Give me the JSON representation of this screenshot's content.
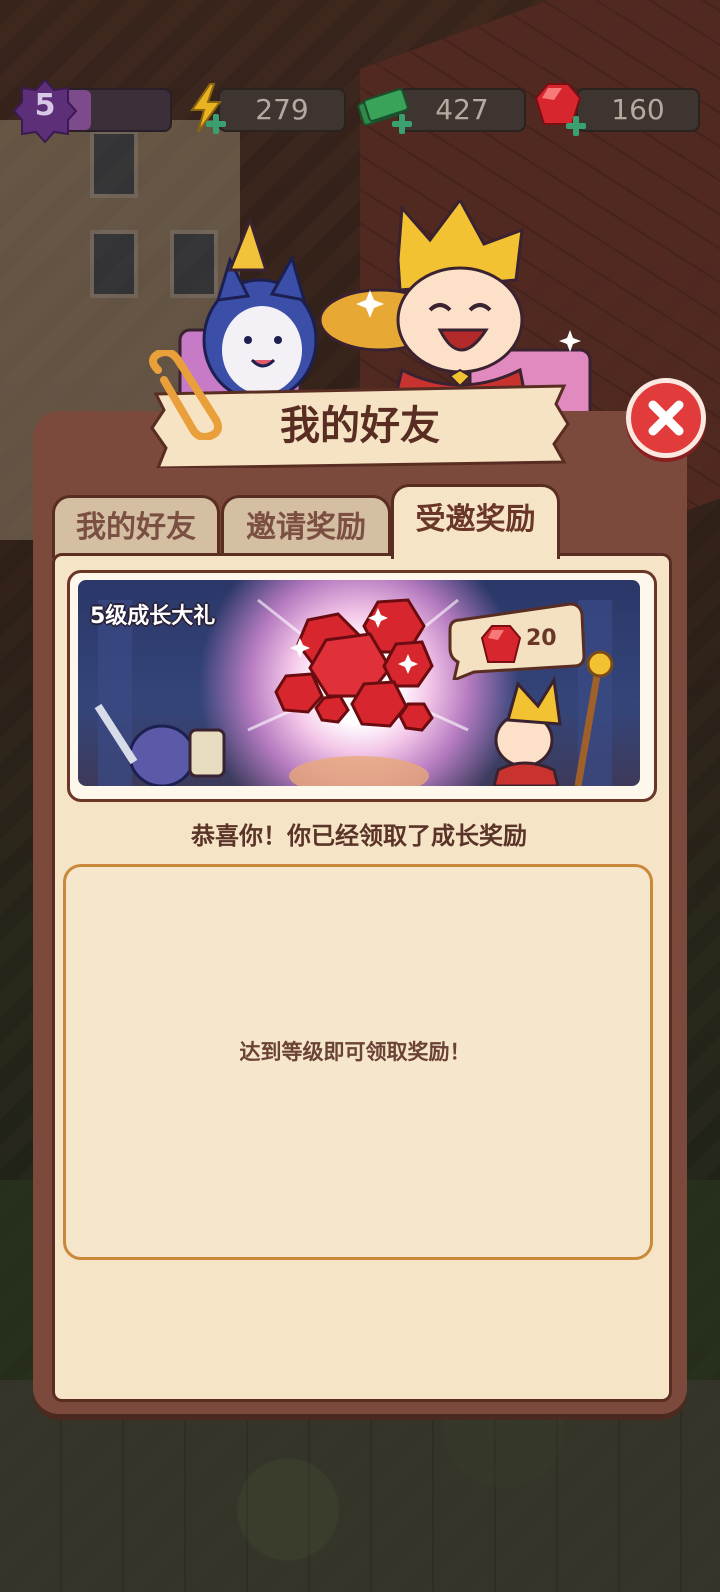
{
  "hud": {
    "level": "5",
    "level_progress": 0.25,
    "energy": "279",
    "cash": "427",
    "gems": "160"
  },
  "panel": {
    "title": "我的好友",
    "tabs": [
      {
        "label": "我的好友",
        "active": false
      },
      {
        "label": "邀请奖励",
        "active": false
      },
      {
        "label": "受邀奖励",
        "active": true
      }
    ],
    "reward_card": {
      "title": "5级成长大礼",
      "gem_amount": "20"
    },
    "congrats_text": "恭喜你！你已经领取了成长奖励",
    "empty_message": "达到等级即可领取奖励！"
  },
  "colors": {
    "panel_frame": "#7c4a3c",
    "panel_fill": "#f6e4c6",
    "close_button": "#e23b3b",
    "gem_red": "#d8262e"
  },
  "icons": [
    "level-badge-icon",
    "energy-bolt-icon",
    "cash-stack-icon",
    "ruby-gem-icon",
    "close-icon"
  ]
}
